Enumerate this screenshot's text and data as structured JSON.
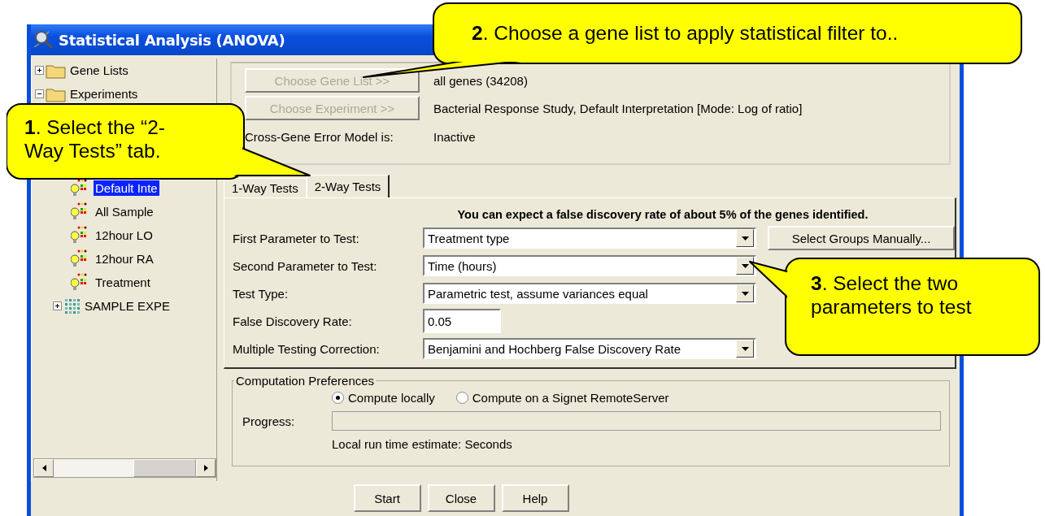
{
  "window": {
    "title": "Statistical Analysis (ANOVA)"
  },
  "tree": {
    "items": [
      {
        "label": "Gene Lists",
        "kind": "folder",
        "expanded": false
      },
      {
        "label": "Experiments",
        "kind": "folder",
        "expanded": true,
        "children": [
          {
            "kind": "hidden",
            "children": [
              {
                "label": "Default Inte",
                "kind": "interpretation",
                "selected": true
              },
              {
                "label": "All Sample",
                "kind": "interpretation",
                "selected": false
              },
              {
                "label": "12hour LO",
                "kind": "interpretation",
                "selected": false
              },
              {
                "label": "12hour RA",
                "kind": "interpretation",
                "selected": false
              },
              {
                "label": "Treatment",
                "kind": "interpretation",
                "selected": false
              }
            ]
          },
          {
            "label": "SAMPLE EXPE",
            "kind": "experiment",
            "expanded": false
          }
        ]
      }
    ]
  },
  "source": {
    "rows": [
      {
        "kind": "button",
        "button": "Choose Gene List >>",
        "disabled": true,
        "value": "all genes (34208)"
      },
      {
        "kind": "button",
        "button": "Choose Experiment >>",
        "disabled": true,
        "value": "Bacterial Response Study, Default Interpretation [Mode: Log of ratio]"
      },
      {
        "kind": "label",
        "label": "Cross-Gene Error Model is:",
        "value": "Inactive"
      }
    ]
  },
  "tabs": [
    {
      "label": "1-Way Tests",
      "selected": false
    },
    {
      "label": "2-Way Tests",
      "selected": true
    }
  ],
  "test_panel": {
    "notice": "You can expect a false discovery rate of about 5% of the genes identified.",
    "fields": [
      {
        "label": "First Parameter to Test:",
        "kind": "dropdown",
        "value": "Treatment type"
      },
      {
        "label": "Second Parameter to Test:",
        "kind": "dropdown",
        "value": "Time (hours)"
      },
      {
        "label": "Test Type:",
        "kind": "dropdown",
        "value": "Parametric test, assume variances equal"
      },
      {
        "label": "False Discovery Rate:",
        "kind": "text",
        "value": "0.05"
      },
      {
        "label": "Multiple Testing Correction:",
        "kind": "dropdown",
        "value": "Benjamini and Hochberg False Discovery Rate"
      }
    ],
    "select_groups_button": "Select Groups Manually..."
  },
  "computation": {
    "title": "Computation Preferences",
    "options": [
      {
        "label": "Compute locally",
        "selected": true
      },
      {
        "label": "Compute on a Signet RemoteServer",
        "selected": false
      }
    ],
    "progress_label": "Progress:",
    "progress": {
      "level": 0
    },
    "estimate": "Local run time estimate: Seconds"
  },
  "buttons": [
    "Start",
    "Close",
    "Help"
  ],
  "callouts": [
    {
      "lines": [
        "**1**. Select the “2-",
        "Way Tests” tab."
      ]
    },
    {
      "lines": [
        "**2**. Choose a gene list to apply statistical filter to.."
      ]
    },
    {
      "lines": [
        "**3**. Select the two",
        "parameters to test"
      ]
    }
  ]
}
